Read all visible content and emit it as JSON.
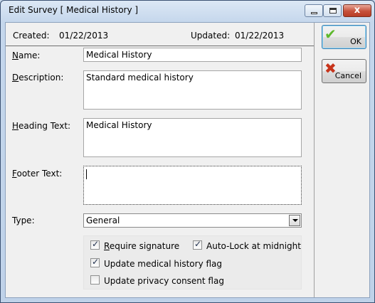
{
  "window": {
    "title": "Edit Survey [ Medical History ]",
    "close_glyph": "x"
  },
  "header": {
    "created_label": "Created:",
    "created_value": "01/22/2013",
    "updated_label": "Updated:",
    "updated_value": "01/22/2013"
  },
  "form": {
    "name": {
      "label_mnemonic": "N",
      "label_rest": "ame:",
      "value": "Medical History"
    },
    "description": {
      "label_mnemonic": "D",
      "label_rest": "escription:",
      "value": "Standard medical history"
    },
    "heading": {
      "label_mnemonic": "H",
      "label_rest": "eading Text:",
      "value": "Medical History"
    },
    "footer": {
      "label_mnemonic": "F",
      "label_rest": "ooter Text:",
      "value": ""
    },
    "type": {
      "label": "Type:",
      "value": "General"
    }
  },
  "options": {
    "require_signature": {
      "label_mnemonic": "R",
      "label_rest": "equire signature",
      "checked": true
    },
    "auto_lock": {
      "label": "Auto-Lock at midnight",
      "checked": true
    },
    "update_medical": {
      "label": "Update medical history flag",
      "checked": true
    },
    "update_privacy": {
      "label": "Update privacy consent flag",
      "checked": false
    }
  },
  "buttons": {
    "ok": "OK",
    "cancel": "Cancel"
  },
  "colors": {
    "ok_icon": "#5db82c",
    "cancel_icon": "#c7341b",
    "close_button": "#c6513b"
  },
  "icons": {
    "ok": "checkmark-icon",
    "cancel": "x-icon"
  }
}
